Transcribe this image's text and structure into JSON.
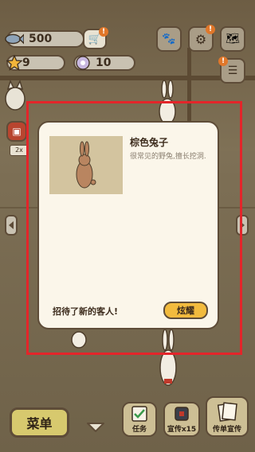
{
  "top_bar": {
    "fish_count": "500",
    "star_count": "9",
    "gem_count": "10",
    "side_counter": "2x"
  },
  "dialog": {
    "guest_name": "棕色兔子",
    "guest_desc": "很常见的野兔,擅长挖洞.",
    "message": "招待了新的客人!",
    "show_button": "炫耀"
  },
  "bottom_bar": {
    "menu_label": "菜单",
    "task_label": "任务",
    "promo_label": "宣传x15",
    "flyer_label": "传单宣传"
  },
  "colors": {
    "highlight_frame": "#e3252a",
    "show_button_bg": "#f2bb3e",
    "badge": "#e0772a"
  }
}
